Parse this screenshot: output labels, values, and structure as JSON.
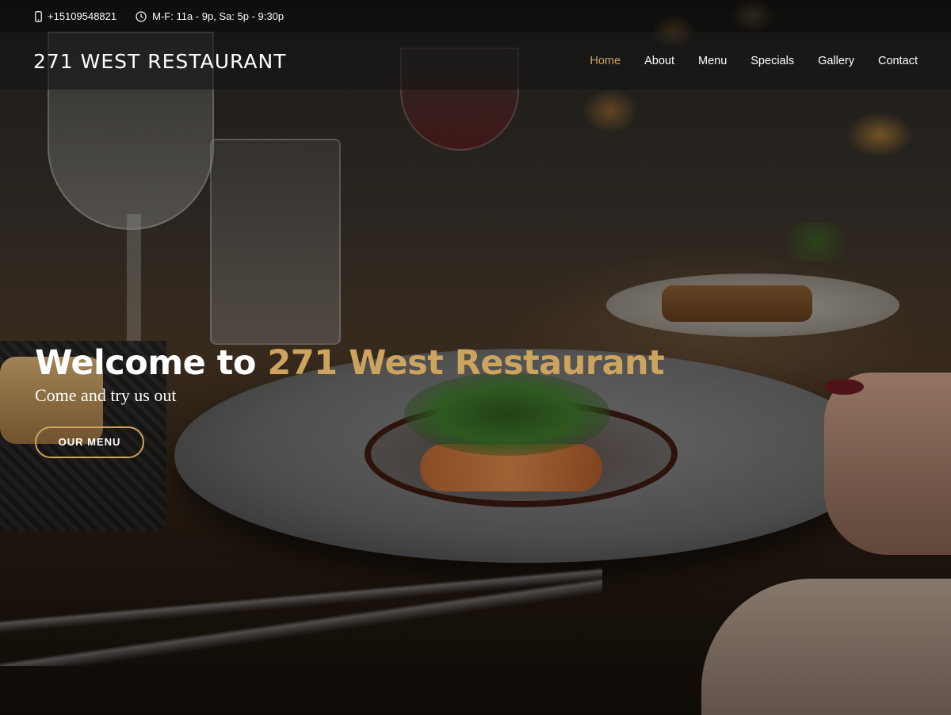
{
  "topbar": {
    "phone": "+15109548821",
    "hours": "M-F: 11a - 9p, Sa: 5p - 9:30p",
    "phone_icon": "phone-icon",
    "hours_icon": "clock-icon"
  },
  "header": {
    "logo": "271 WEST RESTAURANT",
    "nav": [
      {
        "label": "Home",
        "active": true
      },
      {
        "label": "About"
      },
      {
        "label": "Menu"
      },
      {
        "label": "Specials"
      },
      {
        "label": "Gallery"
      },
      {
        "label": "Contact"
      }
    ]
  },
  "hero": {
    "title_prefix": "Welcome to ",
    "title_accent": "271 West Restaurant",
    "subtitle": "Come and try us out",
    "button_label": "OUR MENU"
  },
  "colors": {
    "accent": "#cda45e",
    "text": "#ffffff"
  }
}
